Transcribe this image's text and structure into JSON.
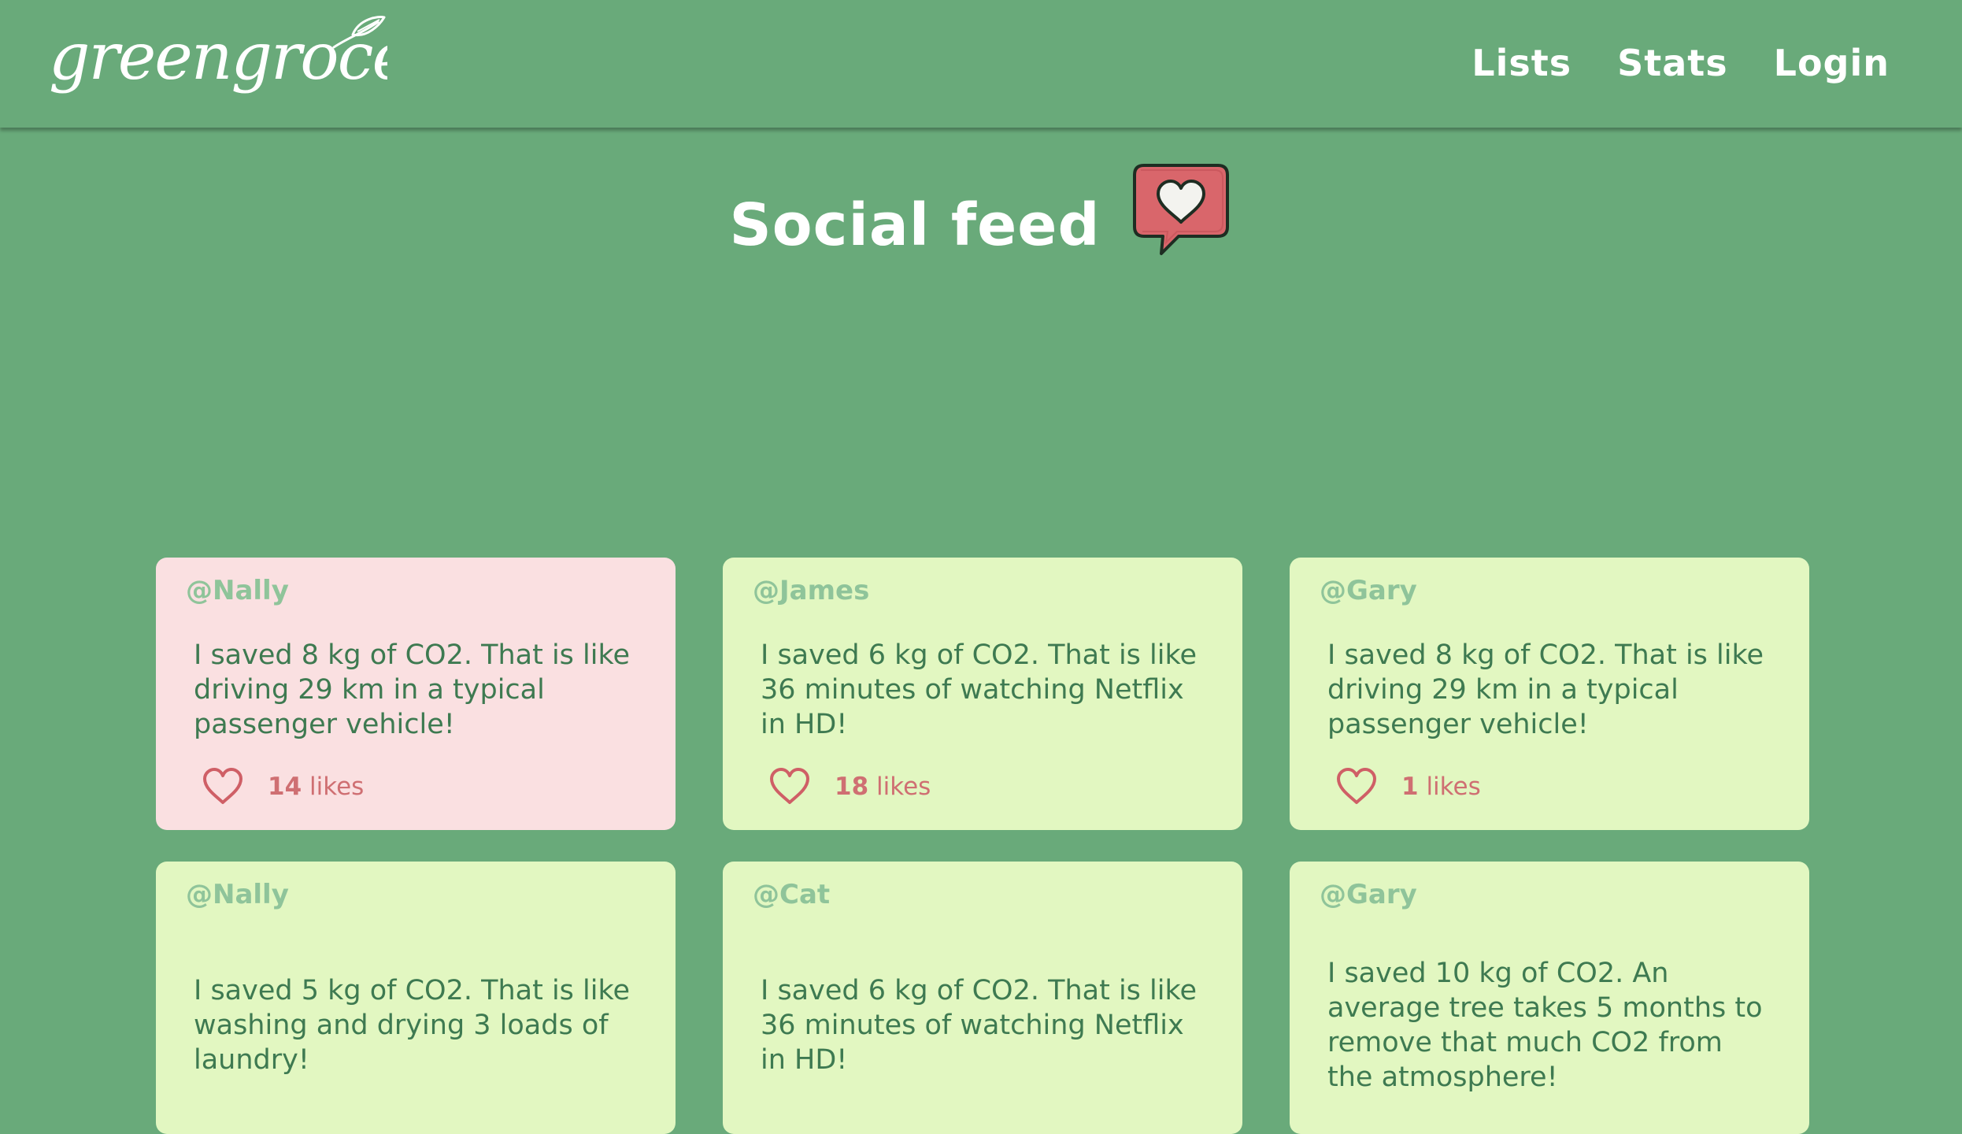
{
  "brand": {
    "logo_text": "greengrocer"
  },
  "nav": {
    "items": [
      {
        "label": "Lists"
      },
      {
        "label": "Stats"
      },
      {
        "label": "Login"
      }
    ]
  },
  "page": {
    "title": "Social feed",
    "title_icon": "heart-speech-bubble-icon"
  },
  "colors": {
    "background": "#69aa7a",
    "card": "#e2f7c1",
    "card_highlight": "#fae0e1",
    "username": "#8fc49a",
    "message": "#3e7a51",
    "likes": "#cf6f72"
  },
  "feed": {
    "posts": [
      {
        "user": "@Nally",
        "message": "I saved 8 kg of CO2. That is like driving 29 km in a typical passenger vehicle!",
        "like_count": "14",
        "like_label": "likes",
        "highlighted": true
      },
      {
        "user": "@James",
        "message": "I saved 6 kg of CO2. That is like 36 minutes of watching Netflix in HD!",
        "like_count": "18",
        "like_label": "likes",
        "highlighted": false
      },
      {
        "user": "@Gary",
        "message": "I saved 8 kg of CO2. That is like driving 29 km in a typical passenger vehicle!",
        "like_count": "1",
        "like_label": "likes",
        "highlighted": false
      },
      {
        "user": "@Nally",
        "message": "I saved 5 kg of CO2. That is like washing and drying 3 loads of laundry!",
        "like_count": "",
        "like_label": "",
        "highlighted": false
      },
      {
        "user": "@Cat",
        "message": "I saved 6 kg of CO2. That is like 36 minutes of watching Netflix in HD!",
        "like_count": "",
        "like_label": "",
        "highlighted": false
      },
      {
        "user": "@Gary",
        "message": "I saved 10 kg of CO2. An average tree takes 5 months to remove that much CO2 from the atmosphere!",
        "like_count": "",
        "like_label": "",
        "highlighted": false
      }
    ]
  }
}
